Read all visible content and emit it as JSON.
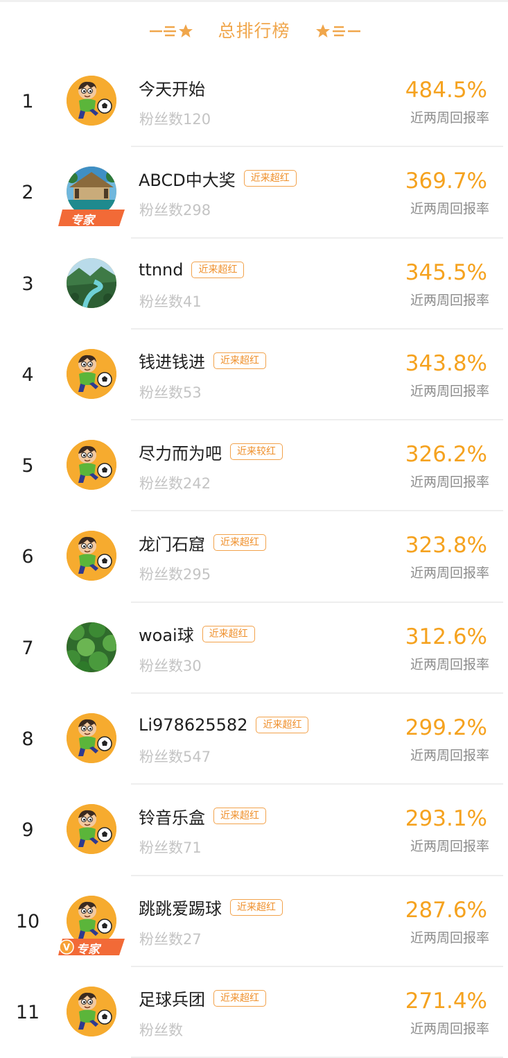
{
  "header": {
    "title": "总排行榜"
  },
  "colors": {
    "accent": "#f5a21f",
    "tag": "#ef8f2a",
    "muted": "#c4c4c4"
  },
  "rate_label": "近两周回报率",
  "rows": [
    {
      "rank": "1",
      "name": "今天开始",
      "tag": "",
      "fans": "粉丝数120",
      "rate": "484.5%",
      "avatar": "soccer-kid",
      "expert": ""
    },
    {
      "rank": "2",
      "name": "ABCD中大奖",
      "tag": "近来超红",
      "fans": "粉丝数298",
      "rate": "369.7%",
      "avatar": "resort",
      "expert": "专家"
    },
    {
      "rank": "3",
      "name": "ttnnd",
      "tag": "近来超红",
      "fans": "粉丝数41",
      "rate": "345.5%",
      "avatar": "river-valley",
      "expert": ""
    },
    {
      "rank": "4",
      "name": "钱进钱进",
      "tag": "近来超红",
      "fans": "粉丝数53",
      "rate": "343.8%",
      "avatar": "soccer-kid",
      "expert": ""
    },
    {
      "rank": "5",
      "name": "尽力而为吧",
      "tag": "近来较红",
      "fans": "粉丝数242",
      "rate": "326.2%",
      "avatar": "soccer-kid",
      "expert": ""
    },
    {
      "rank": "6",
      "name": "龙门石窟",
      "tag": "近来超红",
      "fans": "粉丝数295",
      "rate": "323.8%",
      "avatar": "soccer-kid",
      "expert": ""
    },
    {
      "rank": "7",
      "name": "woai球",
      "tag": "近来超红",
      "fans": "粉丝数30",
      "rate": "312.6%",
      "avatar": "forest",
      "expert": ""
    },
    {
      "rank": "8",
      "name": "Li978625582",
      "tag": "近来超红",
      "fans": "粉丝数547",
      "rate": "299.2%",
      "avatar": "soccer-kid",
      "expert": ""
    },
    {
      "rank": "9",
      "name": "铃音乐盒",
      "tag": "近来超红",
      "fans": "粉丝数71",
      "rate": "293.1%",
      "avatar": "soccer-kid",
      "expert": ""
    },
    {
      "rank": "10",
      "name": "跳跳爱踢球",
      "tag": "近来超红",
      "fans": "粉丝数27",
      "rate": "287.6%",
      "avatar": "soccer-kid",
      "expert": "V专家"
    },
    {
      "rank": "11",
      "name": "足球兵团",
      "tag": "近来超红",
      "fans": "粉丝数",
      "rate": "271.4%",
      "avatar": "soccer-kid",
      "expert": ""
    }
  ]
}
